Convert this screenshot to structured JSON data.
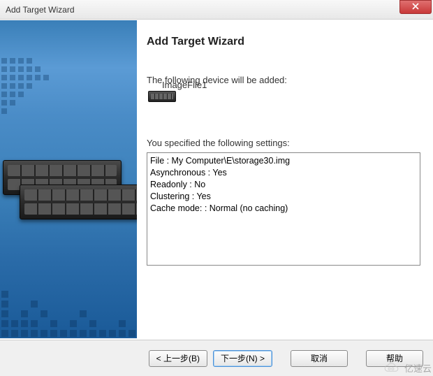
{
  "window": {
    "title": "Add Target Wizard"
  },
  "main": {
    "heading": "Add Target Wizard",
    "device_intro": "The following device will be added:",
    "device_name": "ImageFile1",
    "settings_intro": "You specified the following settings:",
    "settings_lines": [
      "File : My Computer\\E\\storage30.img",
      "Asynchronous : Yes",
      "Readonly : No",
      "Clustering : Yes",
      "Cache mode: : Normal (no caching)"
    ]
  },
  "footer": {
    "back": "< 上一步(B)",
    "next": "下一步(N) >",
    "cancel": "取消",
    "help": "帮助"
  },
  "watermark": "亿速云"
}
